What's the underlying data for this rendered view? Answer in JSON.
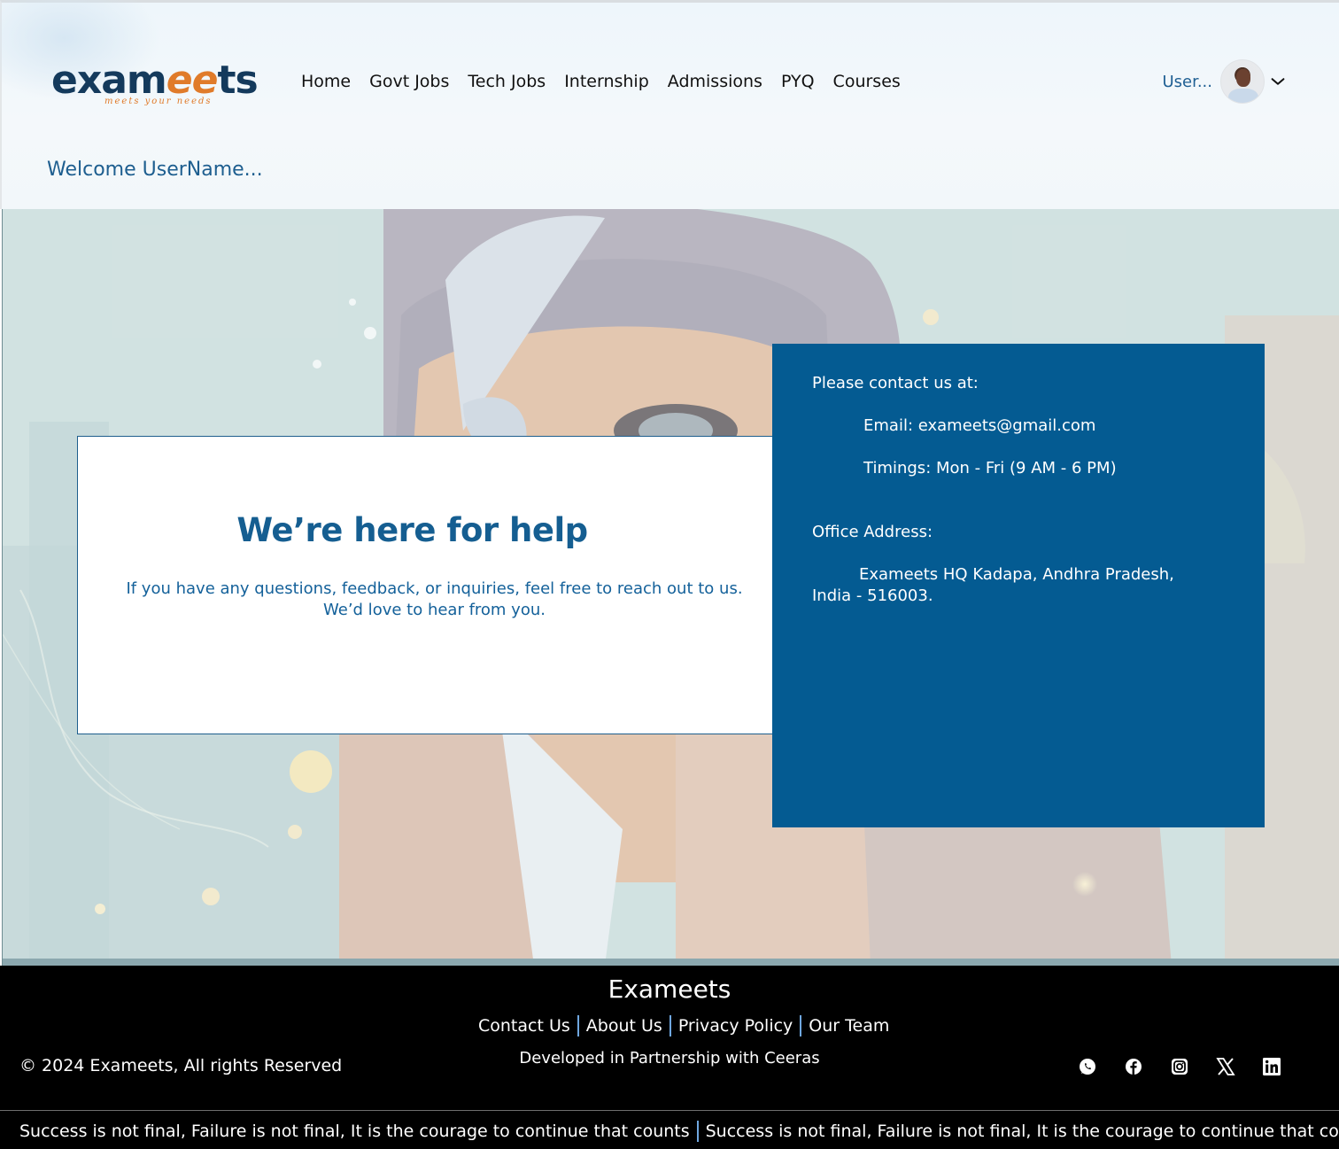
{
  "brand": {
    "logo_main_a": "exam",
    "logo_main_b": "ee",
    "logo_main_c": "ts",
    "logo_tagline": "meets your needs"
  },
  "nav": {
    "items": [
      {
        "label": "Home"
      },
      {
        "label": "Govt Jobs"
      },
      {
        "label": "Tech Jobs"
      },
      {
        "label": "Internship"
      },
      {
        "label": "Admissions"
      },
      {
        "label": "PYQ"
      },
      {
        "label": "Courses"
      }
    ]
  },
  "user": {
    "name": "User...",
    "avatar_icon": "user-avatar",
    "dropdown_icon": "chevron-down-icon"
  },
  "welcome": "Welcome UserName...",
  "help": {
    "title": "We’re here for help",
    "text": "If you have any questions, feedback, or inquiries, feel free to reach out to us. We’d love to hear from you."
  },
  "contact": {
    "heading": "Please contact us at:",
    "email": "Email: exameets@gmail.com",
    "timings": "Timings: Mon - Fri (9 AM - 6 PM)",
    "office_heading": "Office Address:",
    "address_line1": "Exameets HQ Kadapa, Andhra Pradesh,",
    "address_line2": "India - 516003."
  },
  "footer": {
    "brand": "Exameets",
    "links": [
      "Contact Us",
      "About Us",
      "Privacy Policy",
      "Our Team"
    ],
    "partner": "Developed in Partnership with Ceeras",
    "copyright": "© 2024 Exameets, All rights Reserved",
    "social_icons": [
      "whatsapp-icon",
      "facebook-icon",
      "instagram-icon",
      "x-icon",
      "linkedin-icon"
    ]
  },
  "ticker": {
    "text": "Success is not final, Failure is not final, It is the courage to continue that counts",
    "text_cut": "Success is not final, Failure is not final, It is the courage to continue that co"
  },
  "colors": {
    "primary": "#045b92",
    "accent": "#e07b2a",
    "footer_bg": "#000000",
    "link_sep": "#6fa7e0"
  }
}
